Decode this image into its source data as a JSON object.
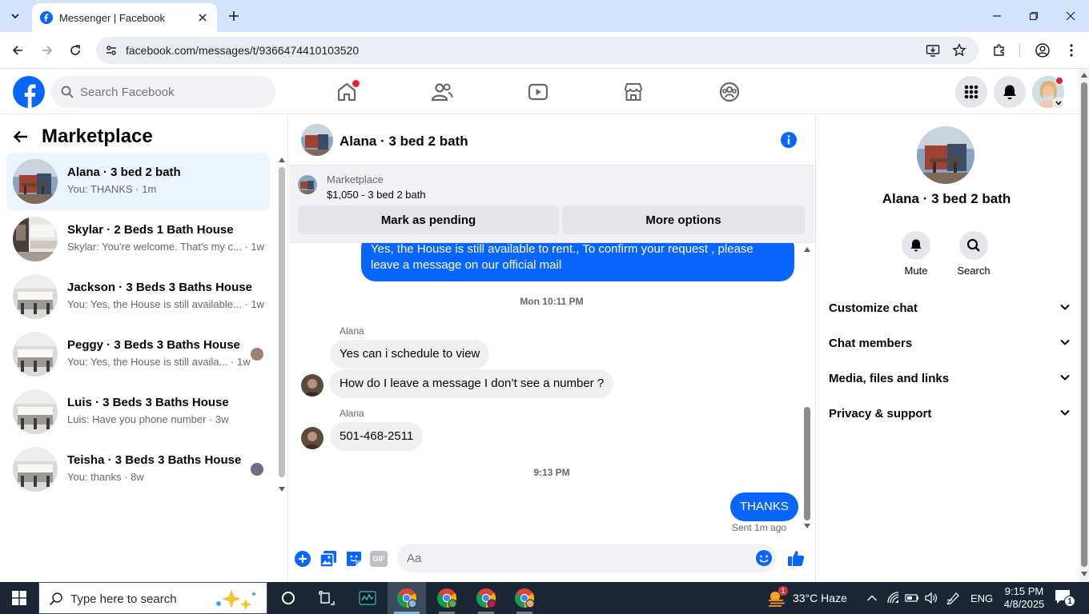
{
  "browser": {
    "tab_title": "Messenger | Facebook",
    "url": "facebook.com/messages/t/9366474410103520"
  },
  "fb": {
    "search_placeholder": "Search Facebook"
  },
  "left": {
    "title": "Marketplace",
    "conversations": [
      {
        "name": "Alana · 3 bed 2 bath",
        "preview": "You: THANKS · 1m"
      },
      {
        "name": "Skylar · 2 Beds 1 Bath House",
        "preview": "Skylar: You're welcome. That's my c... · 1w"
      },
      {
        "name": "Jackson · 3 Beds 3 Baths House",
        "preview": "You: Yes, the House is still available... · 1w"
      },
      {
        "name": "Peggy · 3 Beds 3 Baths House",
        "preview": "You: Yes, the House is still availa... · 1w"
      },
      {
        "name": "Luis · 3 Beds 3 Baths House",
        "preview": "Luis: Have you phone number · 3w"
      },
      {
        "name": "Teisha · 3 Beds 3 Baths House",
        "preview": "You: thanks · 8w"
      }
    ]
  },
  "chat": {
    "title": "Alana · 3 bed 2 bath",
    "listing_label": "Marketplace",
    "listing_detail": "$1,050 - 3 bed 2 bath",
    "mark_pending": "Mark as pending",
    "more_options": "More options",
    "messages": {
      "out1": "Yes, the House is still available to rent., To confirm your request , please leave a message on our official mail",
      "ts1": "Mon 10:11 PM",
      "sender1": "Alana",
      "in1": "Yes can i schedule to view",
      "in2": "How do I leave a message I don’t see a number ?",
      "sender2": "Alana",
      "in3": "501-468-2511",
      "ts2": "9:13 PM",
      "out2": "THANKS",
      "sent_status": "Sent 1m ago"
    },
    "composer_placeholder": "Aa",
    "gif_label": "GIF"
  },
  "right": {
    "name": "Alana · 3 bed 2 bath",
    "actions": [
      "Mute",
      "Search"
    ],
    "sections": [
      "Customize chat",
      "Chat members",
      "Media, files and links",
      "Privacy & support"
    ]
  },
  "taskbar": {
    "search_placeholder": "Type here to search",
    "weather": "33°C  Haze",
    "weather_badge": "1",
    "lang": "ENG",
    "time": "9:15 PM",
    "date": "4/8/2025",
    "notif_count": "1"
  },
  "colors": {
    "brand": "#0866ff",
    "tabbar": "#d3e3fd",
    "taskbar": "#1a2633"
  }
}
